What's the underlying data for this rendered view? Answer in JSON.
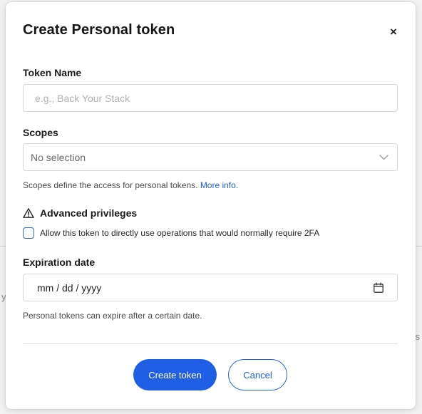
{
  "background": {
    "left_fragment": "y",
    "right_fragment": "s"
  },
  "modal": {
    "title": "Create Personal token",
    "close_symbol": "×"
  },
  "token_name": {
    "label": "Token Name",
    "value": "",
    "placeholder": "e.g., Back Your Stack"
  },
  "scopes": {
    "label": "Scopes",
    "selected": "No selection",
    "help_text": "Scopes define the access for personal tokens. ",
    "help_link": "More info."
  },
  "advanced": {
    "title": "Advanced privileges",
    "checkbox_label": "Allow this token to directly use operations that would normally require 2FA",
    "checked": false
  },
  "expiration": {
    "label": "Expiration date",
    "value": "mm / dd / yyyy",
    "help_text": "Personal tokens can expire after a certain date."
  },
  "actions": {
    "create_label": "Create token",
    "cancel_label": "Cancel"
  },
  "colors": {
    "primary": "#1f5fe6",
    "link": "#1b5fe0",
    "border": "#d6d6d6"
  },
  "icons": {
    "close": "close-icon",
    "dropdown": "chevron-down-icon",
    "warning": "warning-triangle-icon",
    "calendar": "calendar-icon"
  }
}
